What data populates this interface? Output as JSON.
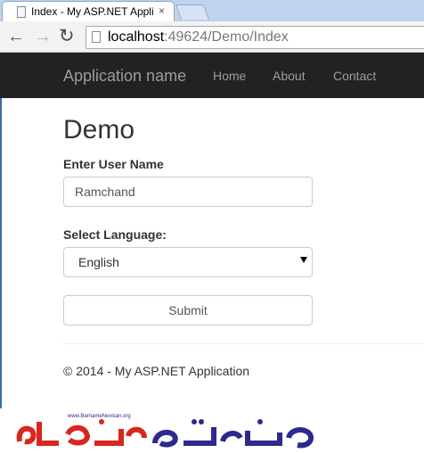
{
  "browser": {
    "tab_title": "Index - My ASP.NET Appli",
    "tab_close": "×",
    "url_host": "localhost",
    "url_path": ":49624/Demo/Index"
  },
  "navbar": {
    "brand": "Application name",
    "links": [
      "Home",
      "About",
      "Contact"
    ]
  },
  "page": {
    "title": "Demo",
    "username_label": "Enter User Name",
    "username_value": "Ramchand",
    "language_label": "Select Language:",
    "language_value": "English",
    "submit_label": "Submit",
    "footer": "© 2014 - My ASP.NET Application"
  },
  "watermark": {
    "url": "www.BarnameNevisan.org",
    "colors": {
      "red": "#d9261c",
      "blue": "#2d2a8c"
    }
  }
}
